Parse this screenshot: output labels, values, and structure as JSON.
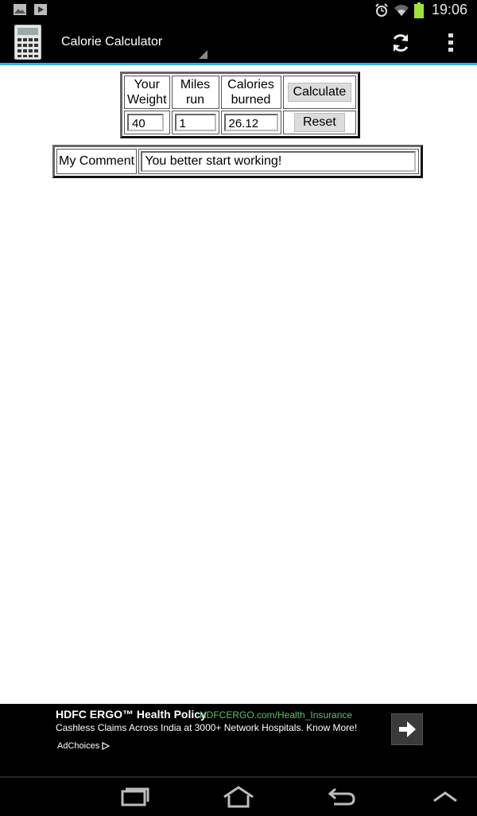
{
  "status_bar": {
    "time": "19:06",
    "left_icons": [
      "image-icon",
      "video-play-icon"
    ],
    "right_icons": [
      "alarm-icon",
      "wifi-icon",
      "battery-icon"
    ],
    "battery_color": "#9ee33a"
  },
  "action_bar": {
    "title": "Calorie Calculator",
    "accent_color": "#33b5e5",
    "icons": [
      "calculator-icon",
      "refresh-icon",
      "overflow-menu-icon"
    ]
  },
  "calculator": {
    "headers": {
      "weight_line1": "Your",
      "weight_line2": "Weight",
      "miles_line1": "Miles",
      "miles_line2": "run",
      "calories_line1": "Calories",
      "calories_line2": "burned"
    },
    "values": {
      "weight": "40",
      "miles": "1",
      "calories": "26.12"
    },
    "buttons": {
      "calculate": "Calculate",
      "reset": "Reset"
    }
  },
  "comment": {
    "label": "My Comment",
    "value": "You better start working!"
  },
  "ad": {
    "headline": "HDFC ERGO™ Health Policy",
    "url": "HDFCERGO.com/Health_Insurance",
    "body": "Cashless Claims Across India at 3000+ Network Hospitals. Know More!",
    "adchoices": "AdChoices",
    "url_color": "#5fbf6a"
  },
  "nav_bar": {
    "icons": [
      "recent-apps-icon",
      "home-icon",
      "back-icon",
      "chevron-up-icon"
    ]
  }
}
